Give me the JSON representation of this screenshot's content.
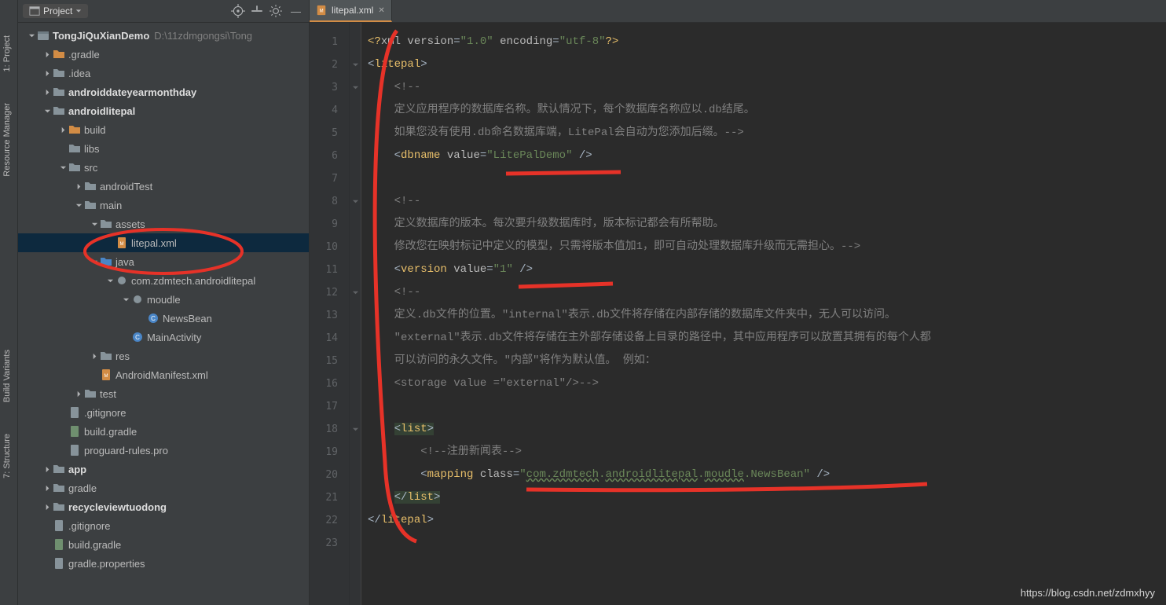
{
  "projectDropdown": "Project",
  "vtabs": [
    "1: Project",
    "Resource Manager",
    "Build Variants",
    "7: Structure"
  ],
  "tree": [
    {
      "depth": 0,
      "tw": "down",
      "icon": "module",
      "bold": true,
      "label": "TongJiQuXianDemo",
      "extra": "D:\\11zdmgongsi\\Tong"
    },
    {
      "depth": 1,
      "tw": "right",
      "icon": "folder-orange",
      "label": ".gradle"
    },
    {
      "depth": 1,
      "tw": "right",
      "icon": "folder",
      "label": ".idea"
    },
    {
      "depth": 1,
      "tw": "right",
      "icon": "folder",
      "bold": true,
      "label": "androiddateyearmonthday"
    },
    {
      "depth": 1,
      "tw": "down",
      "icon": "folder",
      "bold": true,
      "label": "androidlitepal"
    },
    {
      "depth": 2,
      "tw": "right",
      "icon": "folder-orange",
      "label": "build"
    },
    {
      "depth": 2,
      "tw": "",
      "icon": "folder",
      "label": "libs"
    },
    {
      "depth": 2,
      "tw": "down",
      "icon": "folder",
      "label": "src"
    },
    {
      "depth": 3,
      "tw": "right",
      "icon": "folder",
      "label": "androidTest"
    },
    {
      "depth": 3,
      "tw": "down",
      "icon": "folder",
      "label": "main"
    },
    {
      "depth": 4,
      "tw": "down",
      "icon": "folder-assets",
      "label": "assets"
    },
    {
      "depth": 5,
      "tw": "",
      "icon": "file-xml",
      "label": "litepal.xml",
      "selected": true
    },
    {
      "depth": 4,
      "tw": "down",
      "icon": "folder-blue",
      "label": "java"
    },
    {
      "depth": 5,
      "tw": "down",
      "icon": "package",
      "label": "com.zdmtech.androidlitepal"
    },
    {
      "depth": 6,
      "tw": "down",
      "icon": "package",
      "label": "moudle"
    },
    {
      "depth": 7,
      "tw": "",
      "icon": "class",
      "label": "NewsBean"
    },
    {
      "depth": 6,
      "tw": "",
      "icon": "class",
      "label": "MainActivity"
    },
    {
      "depth": 4,
      "tw": "right",
      "icon": "folder-res",
      "label": "res"
    },
    {
      "depth": 4,
      "tw": "",
      "icon": "file-xml",
      "label": "AndroidManifest.xml"
    },
    {
      "depth": 3,
      "tw": "right",
      "icon": "folder",
      "label": "test"
    },
    {
      "depth": 2,
      "tw": "",
      "icon": "file",
      "label": ".gitignore"
    },
    {
      "depth": 2,
      "tw": "",
      "icon": "file-gradle",
      "label": "build.gradle"
    },
    {
      "depth": 2,
      "tw": "",
      "icon": "file",
      "label": "proguard-rules.pro"
    },
    {
      "depth": 1,
      "tw": "right",
      "icon": "folder",
      "bold": true,
      "label": "app"
    },
    {
      "depth": 1,
      "tw": "right",
      "icon": "folder",
      "label": "gradle"
    },
    {
      "depth": 1,
      "tw": "right",
      "icon": "folder",
      "bold": true,
      "label": "recycleviewtuodong"
    },
    {
      "depth": 1,
      "tw": "",
      "icon": "file",
      "label": ".gitignore"
    },
    {
      "depth": 1,
      "tw": "",
      "icon": "file-gradle",
      "label": "build.gradle"
    },
    {
      "depth": 1,
      "tw": "",
      "icon": "file",
      "label": "gradle.properties"
    }
  ],
  "tab_label": "litepal.xml",
  "code": [
    {
      "n": 1,
      "html": "<span class='c-tag'>&lt;?</span><span class='c-attr'>xml version</span>=<span class='c-str'>\"1.0\"</span> <span class='c-attr'>encoding</span>=<span class='c-str'>\"utf-8\"</span><span class='c-tag'>?&gt;</span>"
    },
    {
      "n": 2,
      "html": "&lt;<span class='c-tag'>litepal</span>&gt;"
    },
    {
      "n": 3,
      "html": "    <span class='c-cmt'>&lt;!--</span>"
    },
    {
      "n": 4,
      "html": "    <span class='c-cmt'>定义应用程序的数据库名称。默认情况下，每个数据库名称应以.db结尾。</span>"
    },
    {
      "n": 5,
      "html": "    <span class='c-cmt'>如果您没有使用.db命名数据库端，LitePal会自动为您添加后缀。--&gt;</span>"
    },
    {
      "n": 6,
      "html": "    &lt;<span class='c-tag'>dbname</span> <span class='c-attr'>value</span>=<span class='c-str'>\"LitePalDemo\"</span> /&gt;"
    },
    {
      "n": 7,
      "html": ""
    },
    {
      "n": 8,
      "html": "    <span class='c-cmt'>&lt;!--</span>"
    },
    {
      "n": 9,
      "html": "    <span class='c-cmt'>定义数据库的版本。每次要升级数据库时，版本标记都会有所帮助。</span>"
    },
    {
      "n": 10,
      "html": "    <span class='c-cmt'>修改您在映射标记中定义的模型，只需将版本值加1，即可自动处理数据库升级而无需担心。--&gt;</span>"
    },
    {
      "n": 11,
      "html": "    &lt;<span class='c-tag'>version</span> <span class='c-attr'>value</span>=<span class='c-str'>\"1\"</span> /&gt;"
    },
    {
      "n": 12,
      "html": "    <span class='c-cmt'>&lt;!--</span>"
    },
    {
      "n": 13,
      "html": "    <span class='c-cmt'>定义.db文件的位置。\"internal\"表示.db文件将存储在内部存储的数据库文件夹中，无人可以访问。</span>"
    },
    {
      "n": 14,
      "html": "    <span class='c-cmt'>\"external\"表示.db文件将存储在主外部存储设备上目录的路径中，其中应用程序可以放置其拥有的每个人都</span>"
    },
    {
      "n": 15,
      "html": "    <span class='c-cmt'>可以访问的永久文件。\"内部\"将作为默认值。 例如：</span>"
    },
    {
      "n": 16,
      "html": "    <span class='c-cmt'>&lt;storage value =\"external\"/&gt;--&gt;</span>"
    },
    {
      "n": 17,
      "html": ""
    },
    {
      "n": 18,
      "html": "    <span style='background:#344134'>&lt;<span class='c-tag'>list</span>&gt;</span>"
    },
    {
      "n": 19,
      "html": "        <span class='c-cmt'>&lt;!--注册新闻表--&gt;</span>"
    },
    {
      "n": 20,
      "html": "        &lt;<span class='c-tag'>mapping</span> <span class='c-attr'>class</span>=<span class='c-str'>\"<span style='text-decoration:underline wavy #6a8759'>com.zdmtech</span>.<span style='text-decoration:underline wavy #6a8759'>androidlitepal</span>.<span style='text-decoration:underline wavy #6a8759'>moudle</span>.NewsBean\"</span> /&gt;"
    },
    {
      "n": 21,
      "html": "    <span style='background:#344134'>&lt;/<span class='c-tag'>list</span>&gt;</span>"
    },
    {
      "n": 22,
      "html": "&lt;/<span class='c-tag'>litepal</span>&gt;"
    },
    {
      "n": 23,
      "html": ""
    }
  ],
  "watermark": "https://blog.csdn.net/zdmxhyy"
}
